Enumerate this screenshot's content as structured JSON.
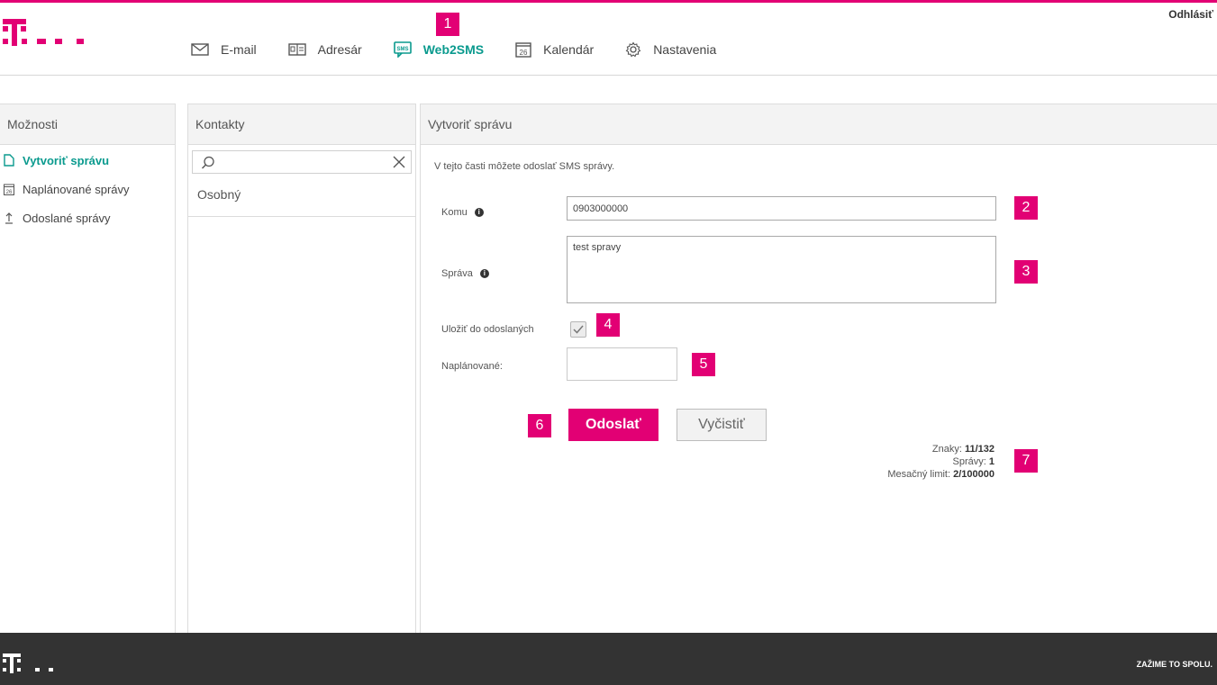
{
  "header": {
    "logout_label": "Odhlásiť",
    "nav": [
      {
        "label": "E-mail",
        "icon": "mail-icon"
      },
      {
        "label": "Adresár",
        "icon": "address-book-icon"
      },
      {
        "label": "Web2SMS",
        "icon": "sms-icon",
        "active": true
      },
      {
        "label": "Kalendár",
        "icon": "calendar-icon"
      },
      {
        "label": "Nastavenia",
        "icon": "gear-icon"
      }
    ]
  },
  "sidebar": {
    "title": "Možnosti",
    "items": [
      {
        "label": "Vytvoriť správu",
        "icon": "document-icon",
        "active": true
      },
      {
        "label": "Naplánované správy",
        "icon": "calendar-icon"
      },
      {
        "label": "Odoslané správy",
        "icon": "upload-arrow-icon"
      }
    ]
  },
  "contacts": {
    "title": "Kontakty",
    "search_value": "",
    "groups": [
      "Osobný"
    ]
  },
  "form": {
    "title": "Vytvoriť správu",
    "intro": "V tejto časti môžete odoslať SMS správy.",
    "to_label": "Komu",
    "to_value": "0903000000",
    "message_label": "Správa",
    "message_value": "test spravy",
    "save_sent_label": "Uložiť do odoslaných",
    "save_sent_checked": true,
    "scheduled_label": "Naplánované:",
    "scheduled_value": "",
    "send_label": "Odoslať",
    "clear_label": "Vyčistiť",
    "stats": {
      "chars_label": "Znaky:",
      "chars_value": "11/132",
      "messages_label": "Správy:",
      "messages_value": "1",
      "limit_label": "Mesačný limit:",
      "limit_value": "2/100000"
    }
  },
  "badges": [
    "1",
    "2",
    "3",
    "4",
    "5",
    "6",
    "7"
  ],
  "footer": {
    "slogan": "ZAŽIME TO SPOLU."
  },
  "colors": {
    "brand": "#e20074",
    "accent": "#0a9a8e",
    "footer": "#333333"
  }
}
